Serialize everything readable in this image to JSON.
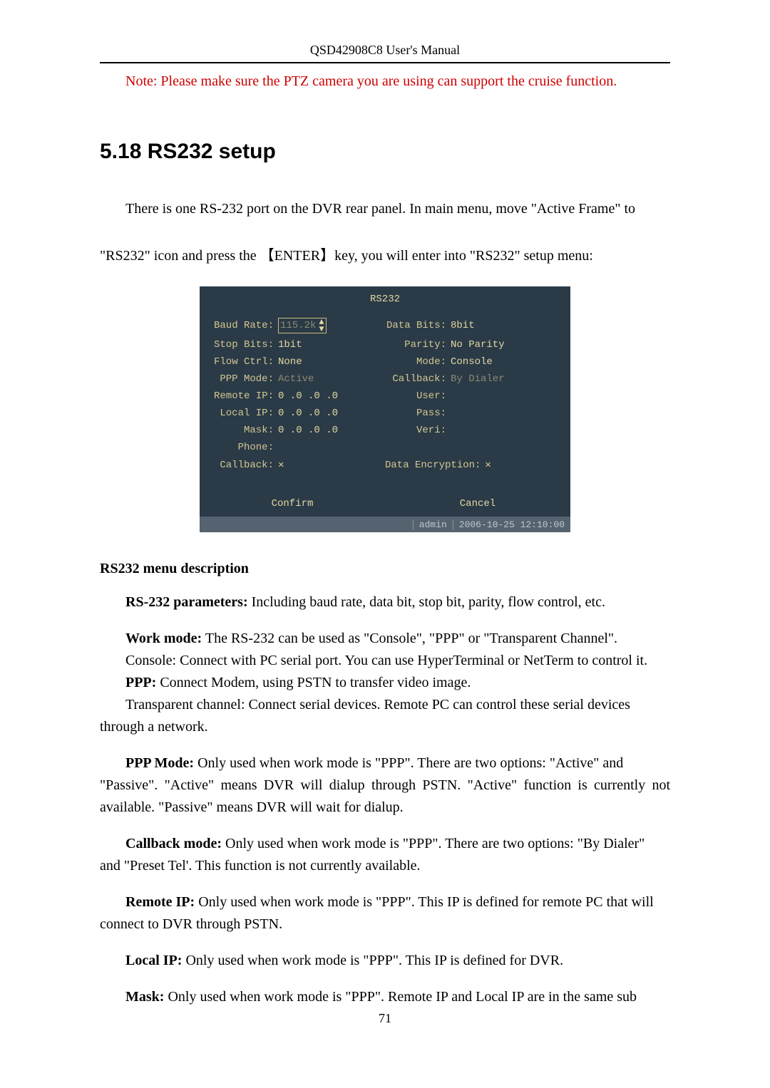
{
  "running_header": "QSD42908C8 User's Manual",
  "note_text": "Note: Please make sure the PTZ camera you are using can support the cruise function.",
  "section_heading": "5.18  RS232 setup",
  "intro_line1": "There is one RS-232 port on the DVR rear panel. In main menu, move \"Active Frame\" to",
  "intro_line2": "\"RS232\" icon and press the 【ENTER】key, you will enter into \"RS232\" setup menu:",
  "dvr": {
    "title": "RS232",
    "baud_rate_label": "Baud Rate:",
    "baud_rate_value": "115.2k",
    "data_bits_label": "Data Bits:",
    "data_bits_value": "8bit",
    "stop_bits_label": "Stop Bits:",
    "stop_bits_value": "1bit",
    "parity_label": "Parity:",
    "parity_value": "No Parity",
    "flow_ctrl_label": "Flow Ctrl:",
    "flow_ctrl_value": "None",
    "mode_label": "Mode:",
    "mode_value": "Console",
    "ppp_mode_label": "PPP Mode:",
    "ppp_mode_value": "Active",
    "callback_mode_label": "Callback:",
    "callback_mode_value": "By Dialer",
    "remote_ip_label": "Remote IP:",
    "remote_ip_value": "0  .0  .0  .0",
    "user_label": "User:",
    "local_ip_label": "Local IP:",
    "local_ip_value": "0  .0  .0  .0",
    "pass_label": "Pass:",
    "mask_label": "Mask:",
    "mask_value": "0  .0  .0  .0",
    "veri_label": "Veri:",
    "phone_label": "Phone:",
    "callback_label": "Callback:",
    "callback_mark": "✕",
    "data_encryption_label": "Data Encryption:",
    "data_encryption_mark": "✕",
    "confirm_btn": "Confirm",
    "cancel_btn": "Cancel",
    "status_user": "admin",
    "status_time": "2006-10-25 12:10:00"
  },
  "subhead": "RS232 menu description",
  "p1_bold": "RS-232 parameters:",
  "p1_rest": " Including baud rate, data bit, stop bit, parity, flow control, etc.",
  "p2_bold": "Work mode:",
  "p2_rest": " The RS-232 can be used as \"Console\", \"PPP\" or \"Transparent Channel\".",
  "p2b": "Console: Connect with PC serial port. You can use HyperTerminal or NetTerm to control it.",
  "p2c_bold": "PPP:",
  "p2c_rest": " Connect Modem, using PSTN to transfer video image.",
  "p2d": "Transparent channel: Connect serial devices. Remote PC can control these serial devices",
  "p2d_cont": "through a network.",
  "p3_bold": "PPP Mode:",
  "p3_rest": " Only used when work mode is \"PPP\".  There are two options: \"Active\" and",
  "p3_cont": "\"Passive\". \"Active\" means DVR will dialup through PSTN. \"Active\" function is currently not available. \"Passive\" means DVR will wait for dialup.",
  "p4_bold": "Callback mode:",
  "p4_rest": " Only used when work mode is \"PPP\".  There are two options: \"By Dialer\"",
  "p4_cont": "and \"Preset Tel'. This function is not currently available.",
  "p5_bold": "Remote IP:",
  "p5_rest": " Only used when work mode is \"PPP\". This IP is defined for remote PC that will",
  "p5_cont": "connect to DVR through PSTN.",
  "p6_bold": "Local IP:",
  "p6_rest": " Only used when work mode is \"PPP\". This IP is defined for DVR.",
  "p7_bold": "Mask:",
  "p7_rest": " Only used when work mode is \"PPP\". Remote IP and Local IP are in the same sub",
  "page_number": "71"
}
